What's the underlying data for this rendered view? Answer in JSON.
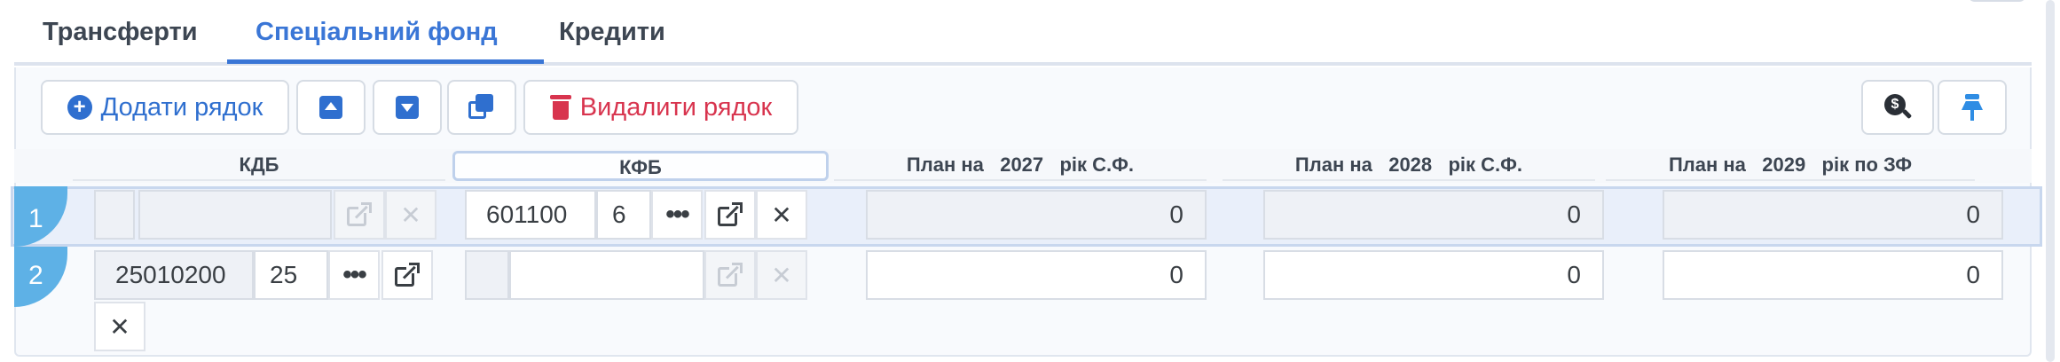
{
  "tabs": [
    {
      "label": "Трансферти",
      "active": false
    },
    {
      "label": "Спеціальний фонд",
      "active": true
    },
    {
      "label": "Кредити",
      "active": false
    }
  ],
  "toolbar": {
    "add_label": "Додати рядок",
    "delete_label": "Видалити рядок"
  },
  "columns": {
    "kdb": "КДБ",
    "kfb": "КФБ",
    "plan_2027": "План на   2027   рік С.Ф.",
    "plan_2028": "План на   2028   рік С.Ф.",
    "plan_2029": "План на   2029   рік по ЗФ"
  },
  "rows": [
    {
      "number": "1",
      "kdb_code": "",
      "kdb_short": "",
      "kfb_code": "601100",
      "kfb_short": "6",
      "plan_2027": "0",
      "plan_2028": "0",
      "plan_2029": "0"
    },
    {
      "number": "2",
      "kdb_code": "25010200",
      "kdb_short": "25",
      "kfb_code": "",
      "kfb_short": "",
      "plan_2027": "0",
      "plan_2028": "0",
      "plan_2029": "0"
    }
  ],
  "colors": {
    "accent": "#3a76d6",
    "danger": "#d8344e",
    "row_badge": "#5eb1e6",
    "selected_row": "#e9effa"
  },
  "icons": {
    "add": "plus-circle-icon",
    "up": "move-up-icon",
    "down": "move-down-icon",
    "copy": "copy-icon",
    "delete": "trash-icon",
    "search": "search-dollar-icon",
    "pin": "pin-icon",
    "lookup": "more-dots-icon",
    "open": "external-link-icon",
    "clear": "close-icon"
  }
}
